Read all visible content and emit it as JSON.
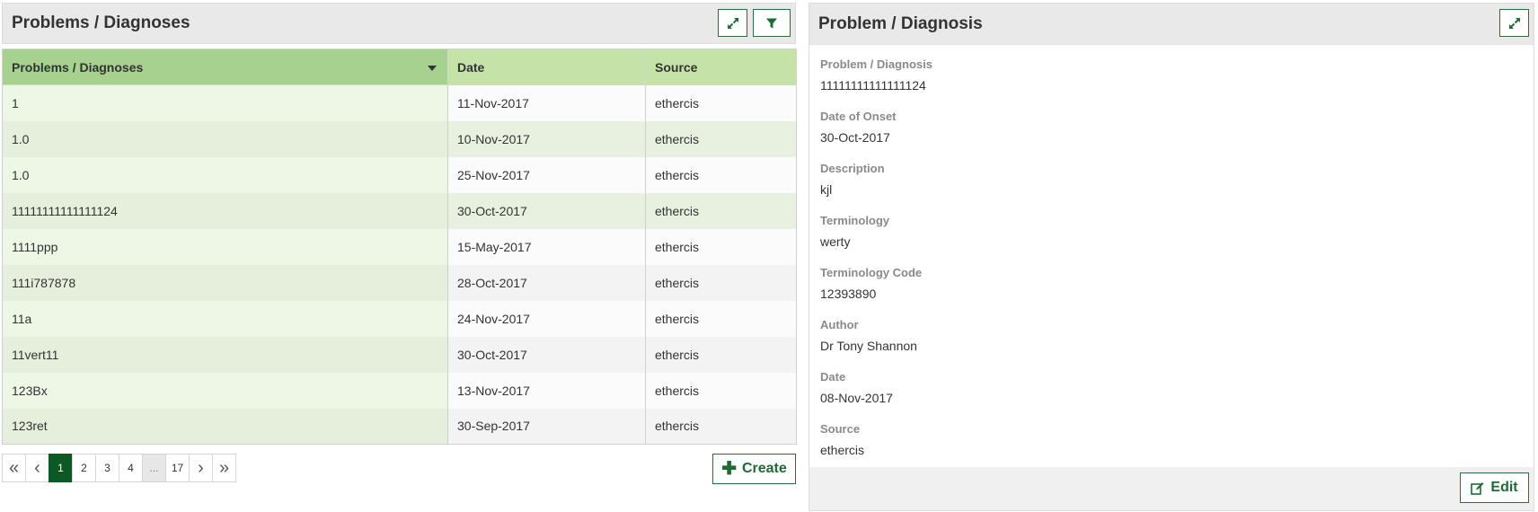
{
  "left_panel": {
    "title": "Problems / Diagnoses",
    "expand_icon": "expand-arrows-icon",
    "filter_icon": "filter-funnel-icon",
    "columns": [
      "Problems / Diagnoses",
      "Date",
      "Source"
    ],
    "sort_icon": "sort-caret-down-icon",
    "rows": [
      {
        "problem": "1",
        "date": "11-Nov-2017",
        "source": "ethercis"
      },
      {
        "problem": "1.0",
        "date": "10-Nov-2017",
        "source": "ethercis"
      },
      {
        "problem": "1.0",
        "date": "25-Nov-2017",
        "source": "ethercis"
      },
      {
        "problem": "11111111111111124",
        "date": "30-Oct-2017",
        "source": "ethercis"
      },
      {
        "problem": "1111ppp",
        "date": "15-May-2017",
        "source": "ethercis"
      },
      {
        "problem": "111i787878",
        "date": "28-Oct-2017",
        "source": "ethercis"
      },
      {
        "problem": "11a",
        "date": "24-Nov-2017",
        "source": "ethercis"
      },
      {
        "problem": "11vert11",
        "date": "30-Oct-2017",
        "source": "ethercis"
      },
      {
        "problem": "123Bx",
        "date": "13-Nov-2017",
        "source": "ethercis"
      },
      {
        "problem": "123ret",
        "date": "30-Sep-2017",
        "source": "ethercis"
      }
    ],
    "pagination": {
      "first": "«",
      "prev": "‹",
      "pages": [
        "1",
        "2",
        "3",
        "4"
      ],
      "current": "1",
      "ellipsis": "...",
      "last_page": "17",
      "next": "›",
      "last": "»"
    },
    "create_label": "Create",
    "create_icon": "plus-icon"
  },
  "right_panel": {
    "title": "Problem / Diagnosis",
    "expand_icon": "expand-arrows-icon",
    "fields": [
      {
        "label": "Problem / Diagnosis",
        "value": "11111111111111124"
      },
      {
        "label": "Date of Onset",
        "value": "30-Oct-2017"
      },
      {
        "label": "Description",
        "value": "kjl"
      },
      {
        "label": "Terminology",
        "value": "werty"
      },
      {
        "label": "Terminology Code",
        "value": "12393890"
      },
      {
        "label": "Author",
        "value": "Dr Tony Shannon"
      },
      {
        "label": "Date",
        "value": "08-Nov-2017"
      },
      {
        "label": "Source",
        "value": "ethercis"
      }
    ],
    "edit_label": "Edit",
    "edit_icon": "edit-pencil-icon"
  },
  "colors": {
    "accent": "#1e6b34",
    "header_primary": "#a6d18e",
    "header_secondary": "#c5e3a8",
    "active_page": "#0b5a23"
  }
}
